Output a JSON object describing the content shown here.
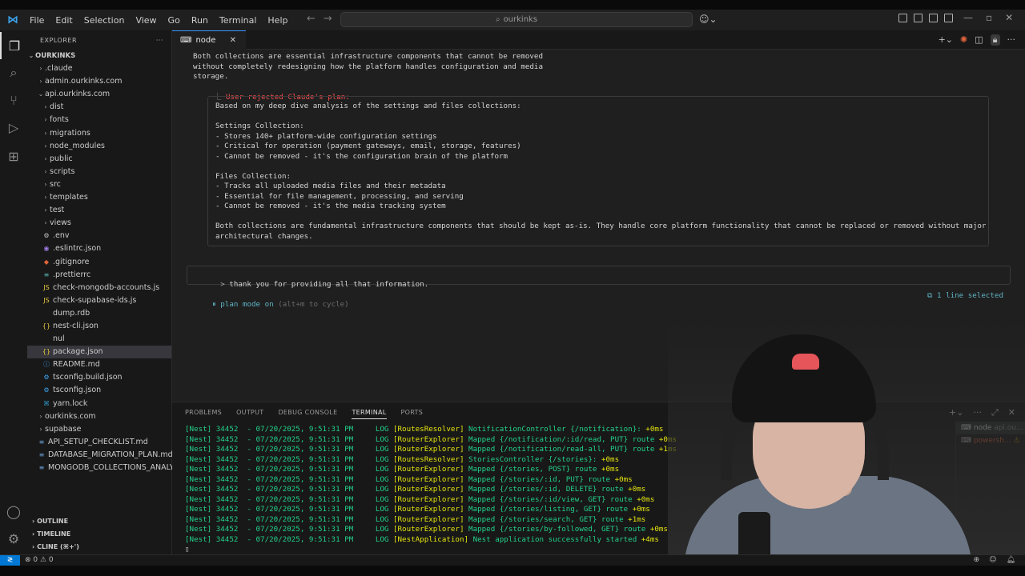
{
  "menu": [
    "File",
    "Edit",
    "Selection",
    "View",
    "Go",
    "Run",
    "Terminal",
    "Help"
  ],
  "search": {
    "text": "ourkinks"
  },
  "sidebar": {
    "title": "EXPLORER",
    "root": "OURKINKS",
    "items": [
      {
        "label": ".claude",
        "type": "folder",
        "depth": 1
      },
      {
        "label": "admin.ourkinks.com",
        "type": "folder",
        "depth": 1
      },
      {
        "label": "api.ourkinks.com",
        "type": "folder-open",
        "depth": 1
      },
      {
        "label": "dist",
        "type": "folder",
        "depth": 2
      },
      {
        "label": "fonts",
        "type": "folder",
        "depth": 2
      },
      {
        "label": "migrations",
        "type": "folder",
        "depth": 2
      },
      {
        "label": "node_modules",
        "type": "folder",
        "depth": 2
      },
      {
        "label": "public",
        "type": "folder",
        "depth": 2
      },
      {
        "label": "scripts",
        "type": "folder",
        "depth": 2
      },
      {
        "label": "src",
        "type": "folder",
        "depth": 2
      },
      {
        "label": "templates",
        "type": "folder",
        "depth": 2
      },
      {
        "label": "test",
        "type": "folder",
        "depth": 2
      },
      {
        "label": "views",
        "type": "folder",
        "depth": 2
      },
      {
        "label": ".env",
        "type": "gear",
        "depth": 2
      },
      {
        "label": ".eslintrc.json",
        "type": "eslint",
        "depth": 2
      },
      {
        "label": ".gitignore",
        "type": "git",
        "depth": 2
      },
      {
        "label": ".prettierrc",
        "type": "prettier",
        "depth": 2
      },
      {
        "label": "check-mongodb-accounts.js",
        "type": "js",
        "depth": 2
      },
      {
        "label": "check-supabase-ids.js",
        "type": "js",
        "depth": 2
      },
      {
        "label": "dump.rdb",
        "type": "file",
        "depth": 2
      },
      {
        "label": "nest-cli.json",
        "type": "json",
        "depth": 2
      },
      {
        "label": "nul",
        "type": "file",
        "depth": 2
      },
      {
        "label": "package.json",
        "type": "json",
        "depth": 2,
        "selected": true
      },
      {
        "label": "README.md",
        "type": "info",
        "depth": 2
      },
      {
        "label": "tsconfig.build.json",
        "type": "ts",
        "depth": 2
      },
      {
        "label": "tsconfig.json",
        "type": "ts",
        "depth": 2
      },
      {
        "label": "yarn.lock",
        "type": "yarn",
        "depth": 2
      },
      {
        "label": "ourkinks.com",
        "type": "folder",
        "depth": 1
      },
      {
        "label": "supabase",
        "type": "folder",
        "depth": 1
      },
      {
        "label": "API_SETUP_CHECKLIST.md",
        "type": "md",
        "depth": 1
      },
      {
        "label": "DATABASE_MIGRATION_PLAN.md",
        "type": "md",
        "depth": 1
      },
      {
        "label": "MONGODB_COLLECTIONS_ANALY...",
        "type": "md",
        "depth": 1
      }
    ],
    "bottom_sections": [
      "OUTLINE",
      "TIMELINE",
      "CLINE (⌘+')"
    ]
  },
  "editor_tab": {
    "label": "node"
  },
  "editor": {
    "intro_lines": [
      "Both collections are essential infrastructure components that cannot be removed",
      "without completely redesigning how the platform handles configuration and media",
      "storage."
    ],
    "rejected_prefix": "⎿",
    "rejected": "User rejected Claude's plan:",
    "plan_lines": [
      "Based on my deep dive analysis of the settings and files collections:",
      "",
      "Settings Collection:",
      "- Stores 140+ platform-wide configuration settings",
      "- Critical for operation (payment gateways, email, storage, features)",
      "- Cannot be removed - it's the configuration brain of the platform",
      "",
      "Files Collection:",
      "- Tracks all uploaded media files and their metadata",
      "- Essential for file management, processing, and serving",
      "- Cannot be removed - it's the media tracking system",
      "",
      "Both collections are fundamental infrastructure components that should be kept as-is. They handle core platform functionality that cannot be replaced or removed without major",
      "architectural changes."
    ],
    "prompt_caret": ">",
    "prompt": "thank you for providing all that information.",
    "mode": "⏸ plan mode on",
    "mode_hint": "(alt+m to cycle)",
    "selection": "⧉ 1 line selected"
  },
  "panel": {
    "tabs": [
      "PROBLEMS",
      "OUTPUT",
      "DEBUG CONSOLE",
      "TERMINAL",
      "PORTS"
    ],
    "active_tab": "TERMINAL",
    "log_lines": [
      {
        "ctx": "[RoutesResolver]",
        "msg": "NotificationController {/notification}:",
        "ms": "+0ms"
      },
      {
        "ctx": "[RouterExplorer]",
        "msg": "Mapped {/notification/:id/read, PUT} route",
        "ms": "+0ms"
      },
      {
        "ctx": "[RouterExplorer]",
        "msg": "Mapped {/notification/read-all, PUT} route",
        "ms": "+1ms"
      },
      {
        "ctx": "[RoutesResolver]",
        "msg": "StoriesController {/stories}:",
        "ms": "+0ms"
      },
      {
        "ctx": "[RouterExplorer]",
        "msg": "Mapped {/stories, POST} route",
        "ms": "+0ms"
      },
      {
        "ctx": "[RouterExplorer]",
        "msg": "Mapped {/stories/:id, PUT} route",
        "ms": "+0ms"
      },
      {
        "ctx": "[RouterExplorer]",
        "msg": "Mapped {/stories/:id, DELETE} route",
        "ms": "+0ms"
      },
      {
        "ctx": "[RouterExplorer]",
        "msg": "Mapped {/stories/:id/view, GET} route",
        "ms": "+0ms"
      },
      {
        "ctx": "[RouterExplorer]",
        "msg": "Mapped {/stories/listing, GET} route",
        "ms": "+0ms"
      },
      {
        "ctx": "[RouterExplorer]",
        "msg": "Mapped {/stories/search, GET} route",
        "ms": "+1ms"
      },
      {
        "ctx": "[RouterExplorer]",
        "msg": "Mapped {/stories/by-followed, GET} route",
        "ms": "+0ms"
      },
      {
        "ctx": "[NestApplication]",
        "msg": "Nest application successfully started",
        "ms": "+4ms"
      }
    ],
    "log_prefix": "[Nest] 34452  - 07/20/2025, 9:51:31 PM     LOG ",
    "terminals": [
      {
        "label": "node",
        "sub": "api.ou..."
      },
      {
        "label": "powersh...",
        "warn": "⚠"
      }
    ]
  },
  "statusbar": {
    "errors": "⊗ 0 ⚠ 0"
  },
  "colors": {
    "accent": "#0078d4",
    "log_green": "#23d18b",
    "log_yellow": "#e5e510",
    "rejected": "#f14c4c"
  }
}
